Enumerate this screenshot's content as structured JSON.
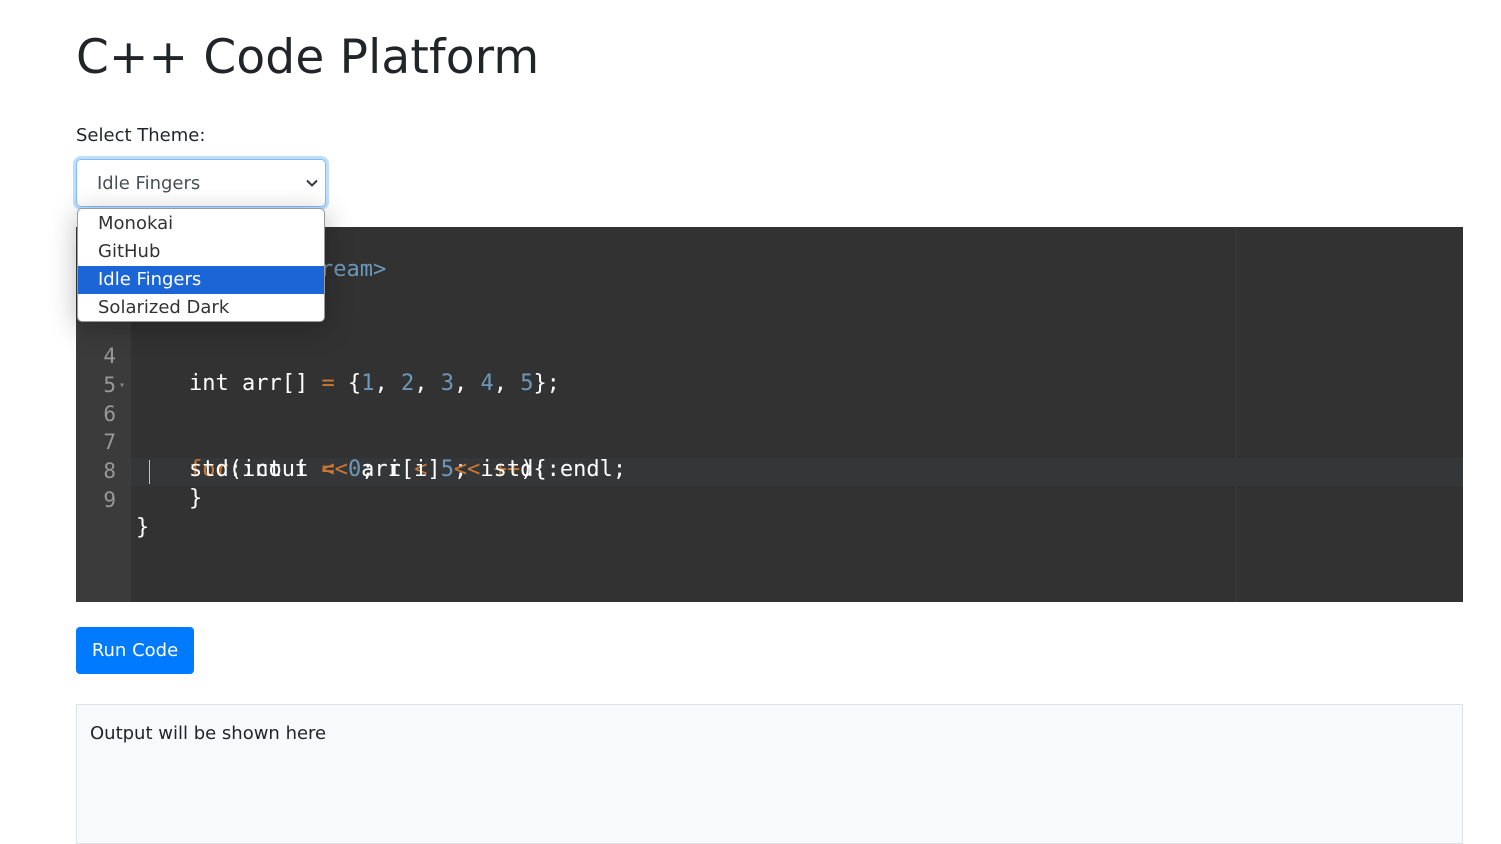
{
  "header": {
    "title": "C++ Code Platform"
  },
  "theme_selector": {
    "label": "Select Theme:",
    "selected": "Idle Fingers",
    "options": [
      "Monokai",
      "GitHub",
      "Idle Fingers",
      "Solarized Dark"
    ],
    "chevron_icon": "chevron-down-icon"
  },
  "editor": {
    "theme_colors": {
      "background": "#323232",
      "gutter": "#3b3b3b",
      "keyword": "#cc7833",
      "number": "#6c99bb",
      "cursor": "#91ff00"
    },
    "visible_fragment_line1": "ream>",
    "lines": [
      {
        "number": "4",
        "text": "    int arr[] = {1, 2, 3, 4, 5};"
      },
      {
        "number": "5",
        "text": ""
      },
      {
        "number": "6",
        "text": "    for(int i = 0; i < 5; i++){"
      },
      {
        "number": "7",
        "text": "    std::cout << arr[i] << std::endl;"
      },
      {
        "number": "8",
        "text": "    }"
      },
      {
        "number": "9",
        "text": "}"
      }
    ]
  },
  "actions": {
    "run_label": "Run Code",
    "run_color": "#007bff"
  },
  "output": {
    "placeholder": "Output will be shown here"
  }
}
